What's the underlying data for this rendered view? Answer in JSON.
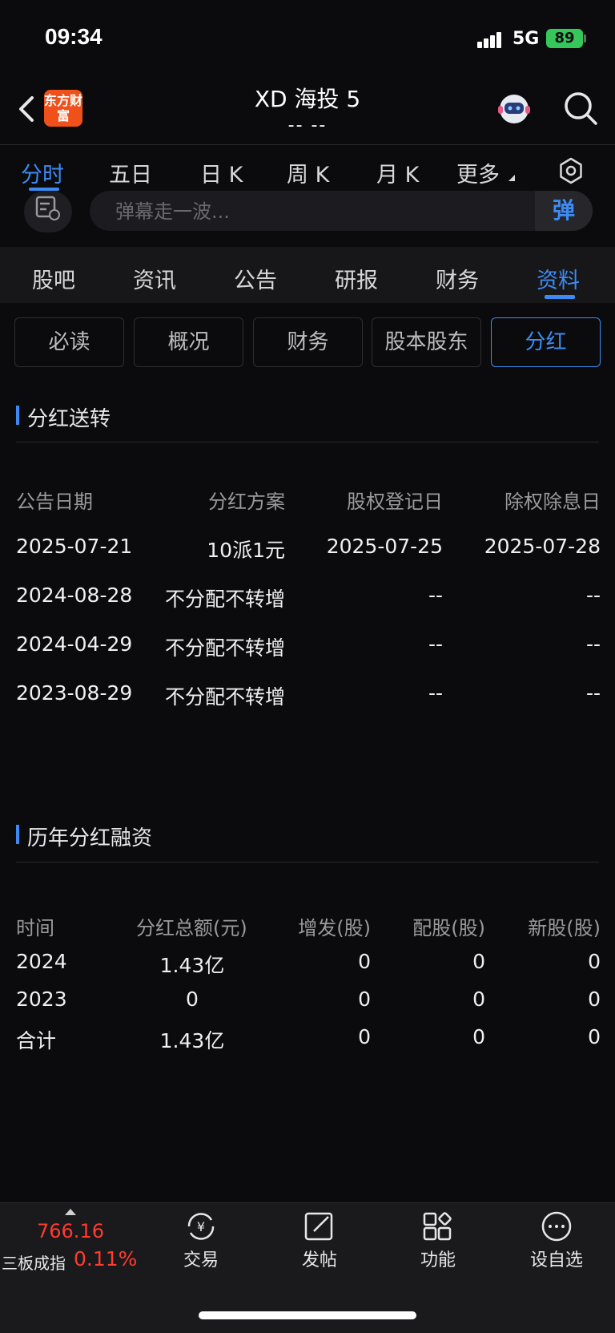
{
  "status_bar": {
    "time": "09:34",
    "network": "5G",
    "battery": "89"
  },
  "header": {
    "app_logo_text": "东方财富",
    "title": "XD 海投 5",
    "subtitle": "-- --"
  },
  "chart_tabs": [
    "分时",
    "五日",
    "日 K",
    "周 K",
    "月 K",
    "更多"
  ],
  "danmu": {
    "placeholder": "弹幕走一波...",
    "send_label": "弹"
  },
  "section_tabs": [
    "股吧",
    "资讯",
    "公告",
    "研报",
    "财务",
    "资料"
  ],
  "sub_tabs": [
    "必读",
    "概况",
    "财务",
    "股本股东",
    "分红"
  ],
  "dividend": {
    "title": "分红送转",
    "headers": [
      "公告日期",
      "分红方案",
      "股权登记日",
      "除权除息日"
    ],
    "rows": [
      [
        "2025-07-21",
        "10派1元",
        "2025-07-25",
        "2025-07-28"
      ],
      [
        "2024-08-28",
        "不分配不转增",
        "--",
        "--"
      ],
      [
        "2024-04-29",
        "不分配不转增",
        "--",
        "--"
      ],
      [
        "2023-08-29",
        "不分配不转增",
        "--",
        "--"
      ]
    ]
  },
  "history": {
    "title": "历年分红融资",
    "headers": [
      "时间",
      "分红总额(元)",
      "增发(股)",
      "配股(股)",
      "新股(股)"
    ],
    "rows": [
      [
        "2024",
        "1.43亿",
        "0",
        "0",
        "0"
      ],
      [
        "2023",
        "0",
        "0",
        "0",
        "0"
      ],
      [
        "合计",
        "1.43亿",
        "0",
        "0",
        "0"
      ]
    ]
  },
  "bottom_bar": {
    "index_price": "766.16",
    "index_name": "三板成指",
    "index_change": "0.11%",
    "nav": [
      "交易",
      "发帖",
      "功能",
      "设自选"
    ]
  },
  "colors": {
    "accent": "#3d8bf2",
    "up": "#ff3b30",
    "background": "#0b0b0d",
    "logo": "#f0511b"
  }
}
